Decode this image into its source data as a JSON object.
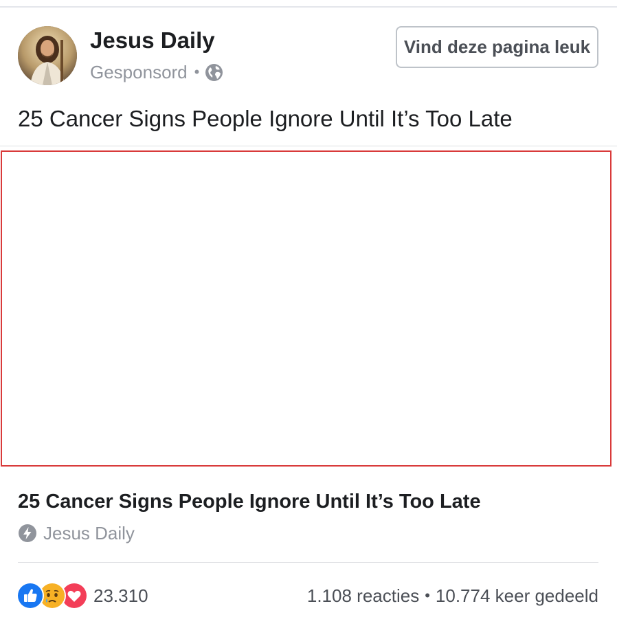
{
  "post": {
    "page_name": "Jesus Daily",
    "sponsored_label": "Gesponsord",
    "meta_separator": "•",
    "like_page_button": "Vind deze pagina leuk",
    "text": "25 Cancer Signs People Ignore Until It’s Too Late",
    "privacy_icon": "globe-icon"
  },
  "link_preview": {
    "title": "25 Cancer Signs People Ignore Until It’s Too Late",
    "source": "Jesus Daily",
    "source_icon": "bolt-icon"
  },
  "engagement": {
    "reaction_icons": [
      "like-reaction-icon",
      "sad-reaction-icon",
      "love-reaction-icon"
    ],
    "reaction_count": "23.310",
    "comments": "1.108 reacties",
    "separator": "•",
    "shares": "10.774 keer gedeeld"
  },
  "colors": {
    "like_blue": "#1877f2",
    "love_red": "#f33e58",
    "sad_yellow": "#f7b125",
    "media_border": "#d93a3a",
    "secondary_text": "#90949c"
  }
}
